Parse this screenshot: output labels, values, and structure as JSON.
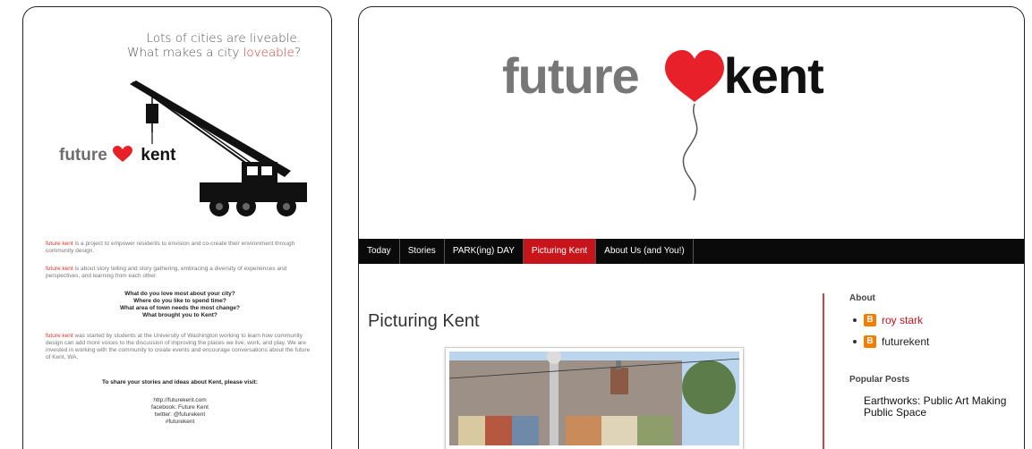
{
  "poster": {
    "tagline_line1": "Lots of cities are liveable.",
    "tagline_line2_prefix": "What makes a city ",
    "tagline_line2_accent": "loveable",
    "tagline_line2_suffix": "?",
    "logo_future": "future",
    "logo_kent": "kent",
    "para1_accent": "future kent",
    "para1_rest": " is a project to empower residents to envision and co-create their environment through community design.",
    "para2_accent": "future kent",
    "para2_rest": " is about story telling and story gathering, embracing a diversity of experiences and perspectives, and learning from each other.",
    "questions": [
      "What do you love most about your city?",
      "Where do you like to spend time?",
      "What area of town needs the most change?",
      "What brought you to Kent?"
    ],
    "para3_accent": "future kent",
    "para3_rest": " was started by students at the University of Washington working to learn how community design can add more voices to the discussion of improving the places we live, work, and play. We are invested in working with the community to create events and encourage conversations about the future of Kent, WA.",
    "share_heading": "To share your stories and ideas about Kent, please visit:",
    "contacts": [
      "http://futurekent.com",
      "facebook: Future Kent",
      "twitter: @futurekent",
      "#futurekent"
    ]
  },
  "blog": {
    "logo_future": "future",
    "logo_kent": "kent",
    "nav": [
      {
        "label": "Today",
        "active": false
      },
      {
        "label": "Stories",
        "active": false
      },
      {
        "label": "PARK(ing) DAY",
        "active": false
      },
      {
        "label": "Picturing Kent",
        "active": true
      },
      {
        "label": "About Us (and You!)",
        "active": false
      }
    ],
    "post_title": "Picturing Kent",
    "sidebar": {
      "about_heading": "About",
      "authors": [
        "roy stark",
        "futurekent"
      ],
      "blogger_icon_letter": "B",
      "popular_heading": "Popular Posts",
      "popular_post_title": "Earthworks: Public Art Making Public Space"
    }
  },
  "colors": {
    "accent_red": "#d9342b",
    "nav_active": "#c8141b",
    "nav_bg": "#0a0a0a",
    "blogger_orange": "#f57d00"
  }
}
